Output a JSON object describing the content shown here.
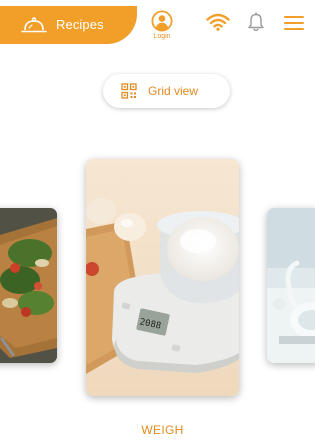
{
  "header": {
    "brand_label": "Recipes",
    "login_label": "Login",
    "accent_color": "#f29f2a",
    "icons": {
      "brand": "cloche-icon",
      "login": "user-circle-icon",
      "wifi": "wifi-icon",
      "notifications": "bell-icon",
      "menu": "hamburger-menu-icon"
    }
  },
  "view_toggle": {
    "label": "Grid view",
    "icon": "grid-view-icon"
  },
  "carousel": {
    "cards": [
      {
        "id": "left",
        "image": "salad-on-cutting-board-image"
      },
      {
        "id": "center",
        "image": "kitchen-scale-with-flour-image",
        "caption": "WEIGH"
      },
      {
        "id": "right",
        "image": "white-appliance-image"
      }
    ]
  }
}
